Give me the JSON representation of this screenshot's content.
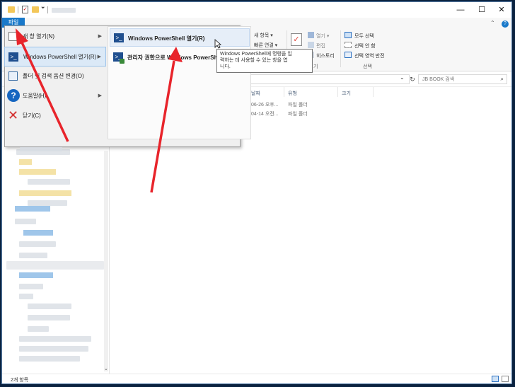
{
  "title_bar": {
    "minimize": "—",
    "maximize": "☐",
    "close": "✕"
  },
  "ribbon": {
    "file_tab": "파일",
    "new_item": "새 항목 ▾",
    "quick_access": "빠른 연결 ▾",
    "open_label": "열기 ▾",
    "edit_label": "편집",
    "history_label": "히스토리",
    "select_all": "모두 선택",
    "select_none": "선택 안 함",
    "invert_selection": "선택 영역 반전",
    "select_group": "선택",
    "open_group_label": "기"
  },
  "search": {
    "placeholder": "JB BOOK 검색"
  },
  "columns": {
    "date": "날짜",
    "type": "유형",
    "size": "크기"
  },
  "rows": [
    {
      "date": "06-26 오후...",
      "type": "파일 폴더"
    },
    {
      "date": "04-14 오전...",
      "type": "파일 폴더"
    }
  ],
  "file_menu": {
    "items": [
      {
        "label": "새 창 열기(N)",
        "has_sub": true
      },
      {
        "label": "Windows PowerShell 열기(R)",
        "has_sub": true
      },
      {
        "label": "폴더 및 검색 옵션 변경(O)",
        "has_sub": false
      },
      {
        "label": "도움말(H)",
        "has_sub": true
      },
      {
        "label": "닫기(C)",
        "has_sub": false
      }
    ],
    "submenu": [
      {
        "label": "Windows PowerShell 열기(R)"
      },
      {
        "label": "관리자 권한으로 Windows PowerShell"
      }
    ]
  },
  "tooltip": {
    "line1": "Windows PowerShell에 명령을 입",
    "line2": "력하는 데 사용할 수 있는 창을 엽",
    "line3": "니다."
  },
  "status": {
    "count": "2개 항목"
  },
  "colors": {
    "accent": "#1979ca",
    "arrow": "#e8242b"
  }
}
